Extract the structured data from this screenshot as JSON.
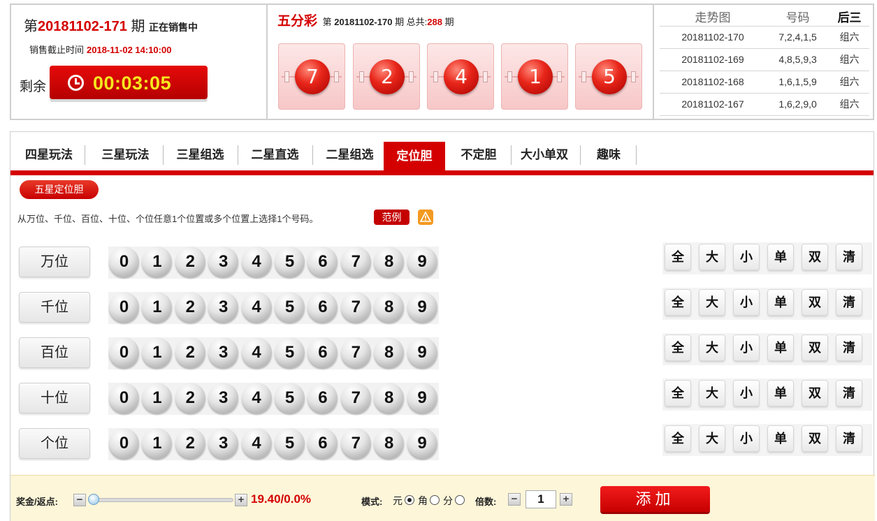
{
  "current": {
    "prefix": "第",
    "issue": "20181102-171",
    "suffix": "期",
    "status": "正在销售中",
    "deadline_label": "销售截止时间",
    "deadline": "2018-11-02 14:10:00",
    "remain_label": "剩余",
    "countdown": "00:03:05"
  },
  "last_draw": {
    "lottery": "五分彩",
    "prefix": "第",
    "issue": "20181102-170",
    "suffix": "期 总共:",
    "total": "288",
    "total_suffix": "期",
    "balls": [
      "7",
      "2",
      "4",
      "1",
      "5"
    ]
  },
  "trend": {
    "headers": [
      "走势图",
      "号码",
      "后三"
    ],
    "rows": [
      {
        "issue": "20181102-170",
        "numbers": "7,2,4,1,5",
        "type": "组六"
      },
      {
        "issue": "20181102-169",
        "numbers": "4,8,5,9,3",
        "type": "组六"
      },
      {
        "issue": "20181102-168",
        "numbers": "1,6,1,5,9",
        "type": "组六"
      },
      {
        "issue": "20181102-167",
        "numbers": "1,6,2,9,0",
        "type": "组六"
      }
    ]
  },
  "tabs": [
    {
      "label": "四星玩法",
      "active": false
    },
    {
      "label": "三星玩法",
      "active": false
    },
    {
      "label": "三星组选",
      "active": false
    },
    {
      "label": "二星直选",
      "active": false
    },
    {
      "label": "二星组选",
      "active": false
    },
    {
      "label": "定位胆",
      "active": true
    },
    {
      "label": "不定胆",
      "active": false
    },
    {
      "label": "大小单双",
      "active": false
    },
    {
      "label": "趣味",
      "active": false
    }
  ],
  "sub_tab": "五星定位胆",
  "description": "从万位、千位、百位、十位、个位任意1个位置或多个位置上选择1个号码。",
  "example_label": "范例",
  "positions": [
    "万位",
    "千位",
    "百位",
    "十位",
    "个位"
  ],
  "digits": [
    "0",
    "1",
    "2",
    "3",
    "4",
    "5",
    "6",
    "7",
    "8",
    "9"
  ],
  "quick_buttons": [
    "全",
    "大",
    "小",
    "单",
    "双",
    "清"
  ],
  "bottom": {
    "bonus_label": "奖金/返点:",
    "minus": "−",
    "plus": "+",
    "bonus_value": "19.40/0.0%",
    "mode_label": "模式:",
    "modes": [
      {
        "label": "元",
        "checked": true
      },
      {
        "label": "角",
        "checked": false
      },
      {
        "label": "分",
        "checked": false
      }
    ],
    "multiplier_label": "倍数:",
    "multiplier": "1",
    "add_label": "添加"
  },
  "colors": {
    "brand_red": "#d40000",
    "countdown_text": "#f5e91e",
    "bottom_bar": "#fdf6d9"
  }
}
